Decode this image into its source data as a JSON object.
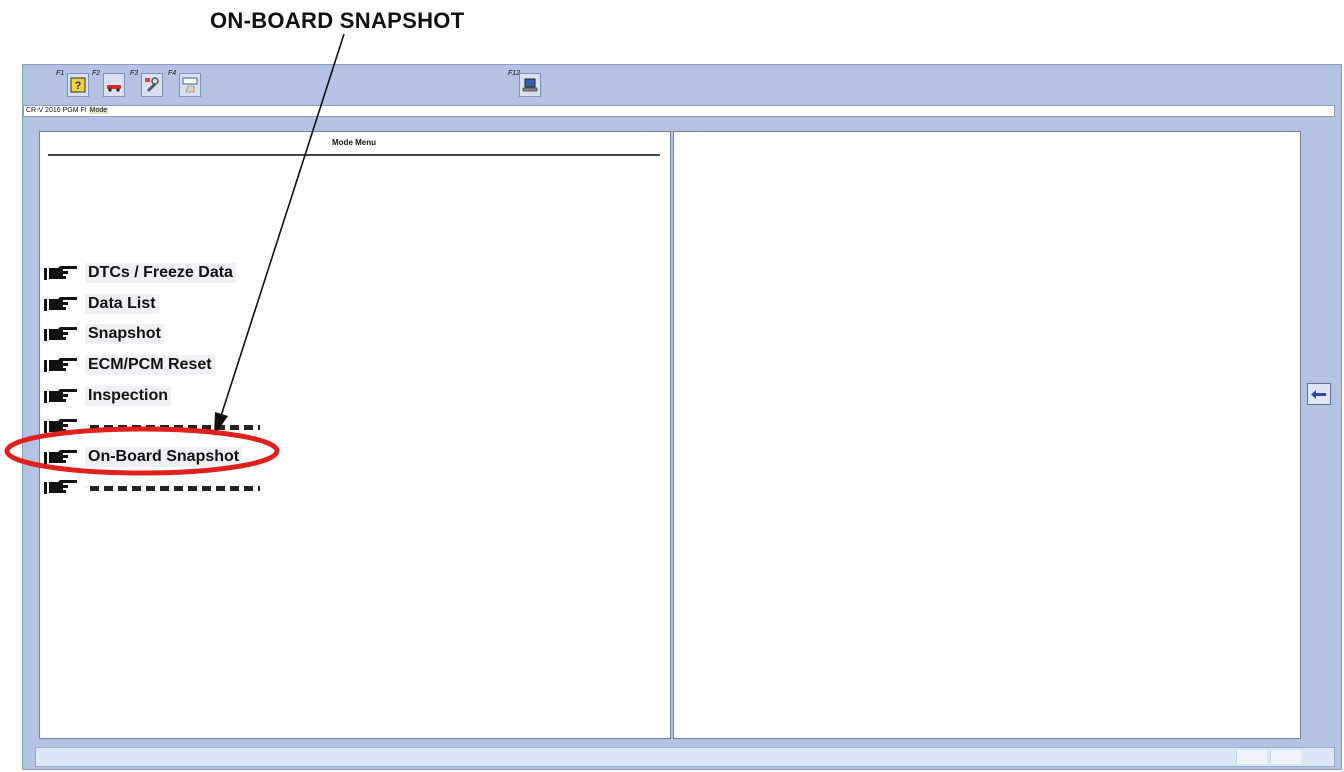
{
  "callout": {
    "title": "ON-BOARD SNAPSHOT"
  },
  "toolbar": {
    "buttons": [
      {
        "fkey": "F1",
        "icon": "help-question-icon"
      },
      {
        "fkey": "F2",
        "icon": "vehicle-icon"
      },
      {
        "fkey": "F3",
        "icon": "service-tool-icon"
      },
      {
        "fkey": "F4",
        "icon": "tool-hand-icon"
      },
      {
        "fkey": "F12",
        "icon": "computer-icon"
      }
    ]
  },
  "status_strip": {
    "vehicle": "CR-V 2016",
    "system": "PGM FI",
    "mode": "Mode"
  },
  "left_panel": {
    "header": "Mode Menu",
    "menu_items": [
      {
        "label": "DTCs / Freeze Data"
      },
      {
        "label": "Data List"
      },
      {
        "label": "Snapshot"
      },
      {
        "label": "ECM/PCM Reset"
      },
      {
        "label": "Inspection"
      },
      {
        "label": ""
      },
      {
        "label": "On-Board Snapshot"
      },
      {
        "label": ""
      }
    ]
  },
  "colors": {
    "window_bg": "#b5c3e3",
    "highlight_ring": "#e0201c",
    "back_arrow": "#2a4fa0"
  }
}
